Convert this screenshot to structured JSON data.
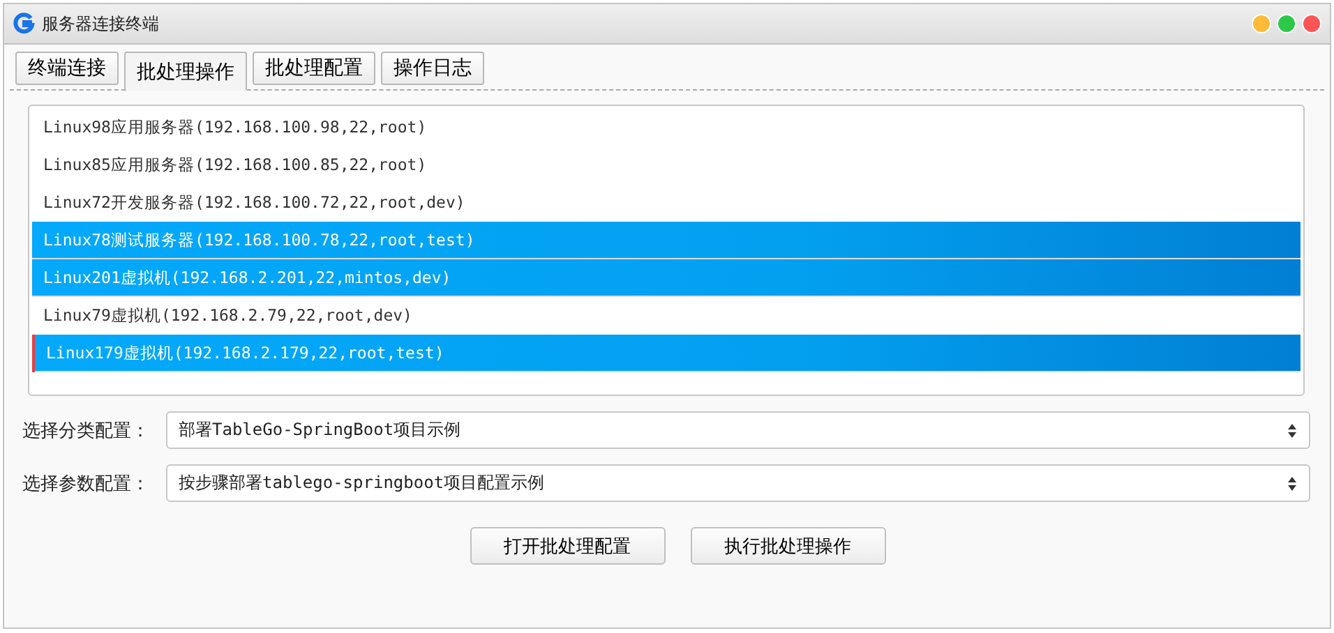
{
  "window": {
    "title": "服务器连接终端"
  },
  "tabs": [
    {
      "label": "终端连接",
      "selected": false
    },
    {
      "label": "批处理操作",
      "selected": true
    },
    {
      "label": "批处理配置",
      "selected": false
    },
    {
      "label": "操作日志",
      "selected": false
    }
  ],
  "servers": [
    {
      "label": "Linux98应用服务器(192.168.100.98,22,root)",
      "selected": false,
      "focused": false
    },
    {
      "label": "Linux85应用服务器(192.168.100.85,22,root)",
      "selected": false,
      "focused": false
    },
    {
      "label": "Linux72开发服务器(192.168.100.72,22,root,dev)",
      "selected": false,
      "focused": false
    },
    {
      "label": "Linux78测试服务器(192.168.100.78,22,root,test)",
      "selected": true,
      "focused": false
    },
    {
      "label": "Linux201虚拟机(192.168.2.201,22,mintos,dev)",
      "selected": true,
      "focused": false
    },
    {
      "label": "Linux79虚拟机(192.168.2.79,22,root,dev)",
      "selected": false,
      "focused": false
    },
    {
      "label": "Linux179虚拟机(192.168.2.179,22,root,test)",
      "selected": true,
      "focused": true
    }
  ],
  "fields": [
    {
      "label": "选择分类配置：",
      "value": "部署TableGo-SpringBoot项目示例"
    },
    {
      "label": "选择参数配置：",
      "value": "按步骤部署tablego-springboot项目配置示例"
    }
  ],
  "buttons": [
    "打开批处理配置",
    "执行批处理操作"
  ]
}
